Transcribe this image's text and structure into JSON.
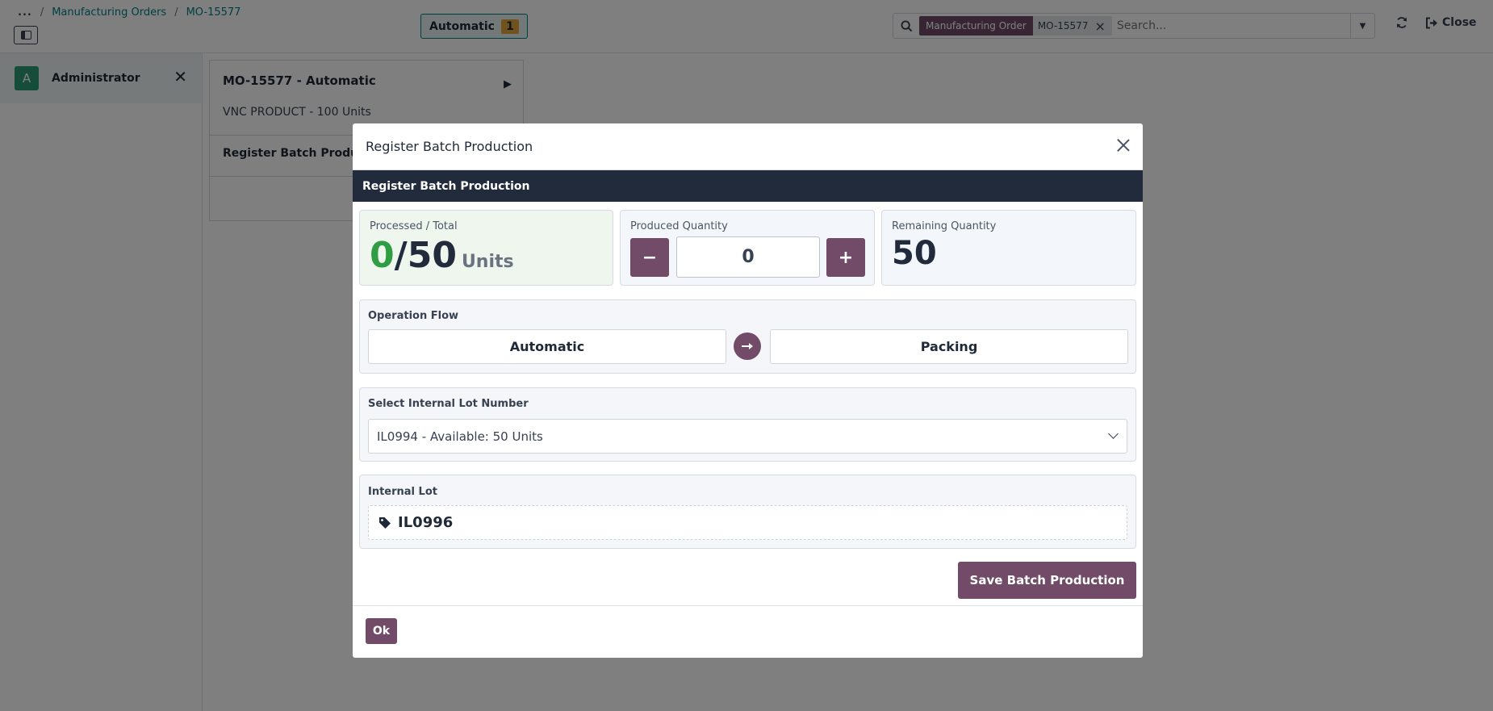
{
  "breadcrumb": {
    "more": "...",
    "items": [
      "Manufacturing Orders",
      "MO-15577"
    ]
  },
  "header": {
    "workcenter_label": "Automatic",
    "workcenter_count": "1",
    "search": {
      "facet_label": "Manufacturing Order",
      "facet_value": "MO-15577",
      "placeholder": "Search..."
    },
    "close_label": "Close"
  },
  "sidebar": {
    "user_initial": "A",
    "user_name": "Administrator"
  },
  "mo_card": {
    "title": "MO-15577 - Automatic",
    "product": "VNC PRODUCT - 100 Units",
    "operation": "Register Batch Production"
  },
  "modal": {
    "title": "Register Batch Production",
    "banner": "Register Batch Production",
    "processed": {
      "label": "Processed / Total",
      "done": "0",
      "slash": "/",
      "total": "50",
      "units": "Units"
    },
    "produced": {
      "label": "Produced Quantity",
      "minus": "−",
      "value": "0",
      "plus": "+"
    },
    "remaining": {
      "label": "Remaining Quantity",
      "value": "50"
    },
    "flow": {
      "label": "Operation Flow",
      "from": "Automatic",
      "to": "Packing"
    },
    "lot_select": {
      "label": "Select Internal Lot Number",
      "selected": "IL0994 - Available: 50 Units"
    },
    "internal_lot": {
      "label": "Internal Lot",
      "value": "IL0996"
    },
    "save_label": "Save Batch Production",
    "ok_label": "Ok"
  },
  "colors": {
    "brand": "#714b67",
    "link": "#017e84",
    "banner": "#212b3b",
    "success": "#2e9d43"
  }
}
